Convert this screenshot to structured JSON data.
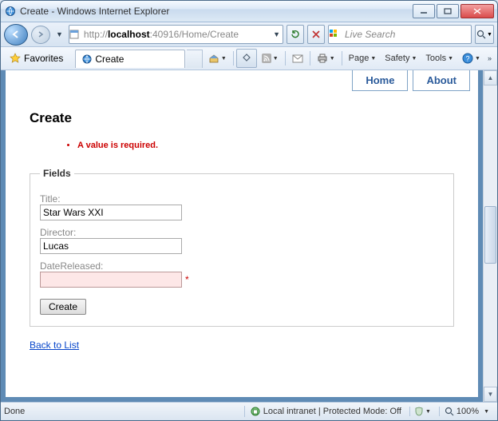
{
  "window": {
    "title": "Create - Windows Internet Explorer"
  },
  "address": {
    "prefix": "http://",
    "host": "localhost",
    "rest": ":40916/Home/Create"
  },
  "search": {
    "placeholder": "Live Search"
  },
  "favorites": {
    "label": "Favorites"
  },
  "tab": {
    "title": "Create"
  },
  "cmdbar": {
    "page": "Page",
    "safety": "Safety",
    "tools": "Tools"
  },
  "nav": {
    "home": "Home",
    "about": "About"
  },
  "page": {
    "heading": "Create",
    "error_item": "A value is required.",
    "legend": "Fields",
    "title_label": "Title:",
    "title_value": "Star Wars XXI",
    "director_label": "Director:",
    "director_value": "Lucas",
    "date_label": "DateReleased:",
    "date_value": "",
    "asterisk": "*",
    "submit": "Create",
    "backlink": "Back to List"
  },
  "status": {
    "done": "Done",
    "zone": "Local intranet | Protected Mode: Off",
    "zoom": "100%"
  }
}
